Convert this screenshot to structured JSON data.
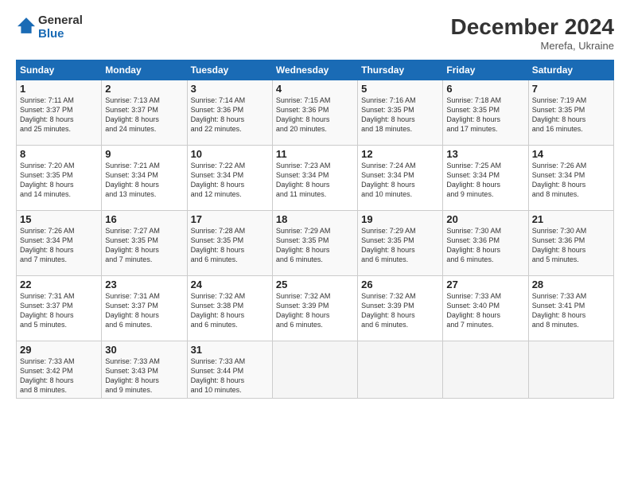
{
  "header": {
    "logo_line1": "General",
    "logo_line2": "Blue",
    "month": "December 2024",
    "location": "Merefa, Ukraine"
  },
  "weekdays": [
    "Sunday",
    "Monday",
    "Tuesday",
    "Wednesday",
    "Thursday",
    "Friday",
    "Saturday"
  ],
  "weeks": [
    [
      {
        "day": "1",
        "info": "Sunrise: 7:11 AM\nSunset: 3:37 PM\nDaylight: 8 hours\nand 25 minutes."
      },
      {
        "day": "2",
        "info": "Sunrise: 7:13 AM\nSunset: 3:37 PM\nDaylight: 8 hours\nand 24 minutes."
      },
      {
        "day": "3",
        "info": "Sunrise: 7:14 AM\nSunset: 3:36 PM\nDaylight: 8 hours\nand 22 minutes."
      },
      {
        "day": "4",
        "info": "Sunrise: 7:15 AM\nSunset: 3:36 PM\nDaylight: 8 hours\nand 20 minutes."
      },
      {
        "day": "5",
        "info": "Sunrise: 7:16 AM\nSunset: 3:35 PM\nDaylight: 8 hours\nand 18 minutes."
      },
      {
        "day": "6",
        "info": "Sunrise: 7:18 AM\nSunset: 3:35 PM\nDaylight: 8 hours\nand 17 minutes."
      },
      {
        "day": "7",
        "info": "Sunrise: 7:19 AM\nSunset: 3:35 PM\nDaylight: 8 hours\nand 16 minutes."
      }
    ],
    [
      {
        "day": "8",
        "info": "Sunrise: 7:20 AM\nSunset: 3:35 PM\nDaylight: 8 hours\nand 14 minutes."
      },
      {
        "day": "9",
        "info": "Sunrise: 7:21 AM\nSunset: 3:34 PM\nDaylight: 8 hours\nand 13 minutes."
      },
      {
        "day": "10",
        "info": "Sunrise: 7:22 AM\nSunset: 3:34 PM\nDaylight: 8 hours\nand 12 minutes."
      },
      {
        "day": "11",
        "info": "Sunrise: 7:23 AM\nSunset: 3:34 PM\nDaylight: 8 hours\nand 11 minutes."
      },
      {
        "day": "12",
        "info": "Sunrise: 7:24 AM\nSunset: 3:34 PM\nDaylight: 8 hours\nand 10 minutes."
      },
      {
        "day": "13",
        "info": "Sunrise: 7:25 AM\nSunset: 3:34 PM\nDaylight: 8 hours\nand 9 minutes."
      },
      {
        "day": "14",
        "info": "Sunrise: 7:26 AM\nSunset: 3:34 PM\nDaylight: 8 hours\nand 8 minutes."
      }
    ],
    [
      {
        "day": "15",
        "info": "Sunrise: 7:26 AM\nSunset: 3:34 PM\nDaylight: 8 hours\nand 7 minutes."
      },
      {
        "day": "16",
        "info": "Sunrise: 7:27 AM\nSunset: 3:35 PM\nDaylight: 8 hours\nand 7 minutes."
      },
      {
        "day": "17",
        "info": "Sunrise: 7:28 AM\nSunset: 3:35 PM\nDaylight: 8 hours\nand 6 minutes."
      },
      {
        "day": "18",
        "info": "Sunrise: 7:29 AM\nSunset: 3:35 PM\nDaylight: 8 hours\nand 6 minutes."
      },
      {
        "day": "19",
        "info": "Sunrise: 7:29 AM\nSunset: 3:35 PM\nDaylight: 8 hours\nand 6 minutes."
      },
      {
        "day": "20",
        "info": "Sunrise: 7:30 AM\nSunset: 3:36 PM\nDaylight: 8 hours\nand 6 minutes."
      },
      {
        "day": "21",
        "info": "Sunrise: 7:30 AM\nSunset: 3:36 PM\nDaylight: 8 hours\nand 5 minutes."
      }
    ],
    [
      {
        "day": "22",
        "info": "Sunrise: 7:31 AM\nSunset: 3:37 PM\nDaylight: 8 hours\nand 5 minutes."
      },
      {
        "day": "23",
        "info": "Sunrise: 7:31 AM\nSunset: 3:37 PM\nDaylight: 8 hours\nand 6 minutes."
      },
      {
        "day": "24",
        "info": "Sunrise: 7:32 AM\nSunset: 3:38 PM\nDaylight: 8 hours\nand 6 minutes."
      },
      {
        "day": "25",
        "info": "Sunrise: 7:32 AM\nSunset: 3:39 PM\nDaylight: 8 hours\nand 6 minutes."
      },
      {
        "day": "26",
        "info": "Sunrise: 7:32 AM\nSunset: 3:39 PM\nDaylight: 8 hours\nand 6 minutes."
      },
      {
        "day": "27",
        "info": "Sunrise: 7:33 AM\nSunset: 3:40 PM\nDaylight: 8 hours\nand 7 minutes."
      },
      {
        "day": "28",
        "info": "Sunrise: 7:33 AM\nSunset: 3:41 PM\nDaylight: 8 hours\nand 8 minutes."
      }
    ],
    [
      {
        "day": "29",
        "info": "Sunrise: 7:33 AM\nSunset: 3:42 PM\nDaylight: 8 hours\nand 8 minutes."
      },
      {
        "day": "30",
        "info": "Sunrise: 7:33 AM\nSunset: 3:43 PM\nDaylight: 8 hours\nand 9 minutes."
      },
      {
        "day": "31",
        "info": "Sunrise: 7:33 AM\nSunset: 3:44 PM\nDaylight: 8 hours\nand 10 minutes."
      },
      {
        "day": "",
        "info": ""
      },
      {
        "day": "",
        "info": ""
      },
      {
        "day": "",
        "info": ""
      },
      {
        "day": "",
        "info": ""
      }
    ]
  ]
}
